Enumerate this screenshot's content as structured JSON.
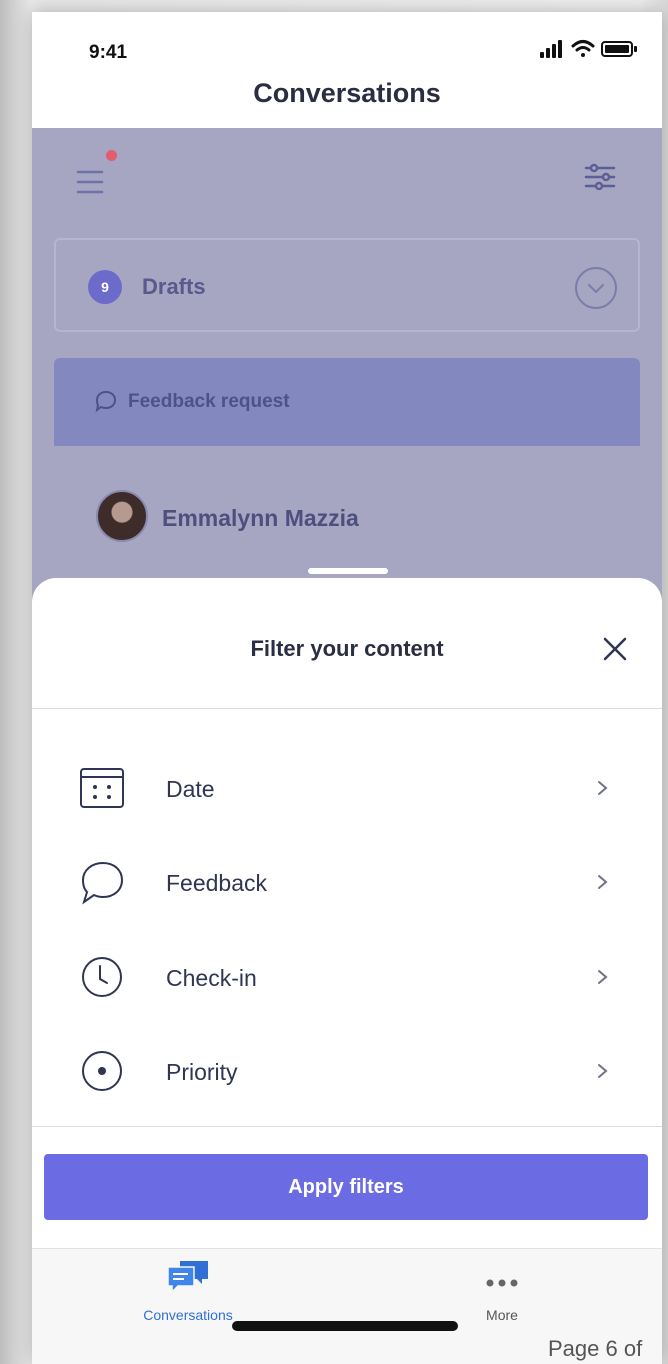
{
  "status_bar": {
    "time": "9:41"
  },
  "header": {
    "title": "Conversations"
  },
  "background": {
    "drafts": {
      "count": "9",
      "label": "Drafts"
    },
    "feedback_card": {
      "label": "Feedback request",
      "person_name": "Emmalynn Mazzia"
    }
  },
  "sheet": {
    "title": "Filter your content",
    "filters": [
      {
        "label": "Date",
        "icon": "calendar-icon"
      },
      {
        "label": "Feedback",
        "icon": "chat-bubble-icon"
      },
      {
        "label": "Check-in",
        "icon": "clock-icon"
      },
      {
        "label": "Priority",
        "icon": "radio-dot-icon"
      }
    ],
    "apply_label": "Apply filters"
  },
  "tabbar": {
    "tabs": [
      {
        "label": "Conversations",
        "icon": "conversations-icon",
        "color": "#2f6fd6"
      },
      {
        "label": "More",
        "icon": "more-dots-icon",
        "color": "#555555"
      }
    ]
  },
  "footer": {
    "text": "Page 6 of"
  },
  "colors": {
    "accent": "#6b6be3",
    "overlay": "#a6a5c2",
    "badge_dot": "#e25d6d"
  }
}
